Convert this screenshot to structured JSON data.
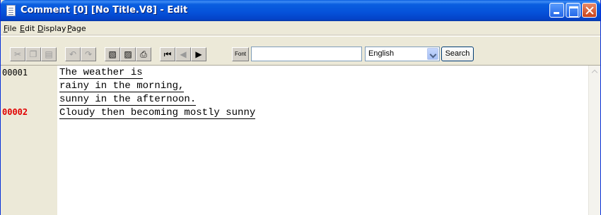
{
  "window": {
    "title": "Comment [0] [No Title.V8] - Edit"
  },
  "menu": [
    {
      "label": "File",
      "accel": "F",
      "rest": "ile"
    },
    {
      "label": "Edit",
      "accel": "E",
      "rest": "dit"
    },
    {
      "label": "Display",
      "accel": "D",
      "rest": "isplay"
    },
    {
      "label": "Page",
      "accel": "P",
      "rest": "age"
    }
  ],
  "toolbar": {
    "font_label": "Font",
    "search_value": "",
    "language": "English",
    "search_label": "Search",
    "icons": [
      "cut-icon",
      "copy-icon",
      "paste-icon",
      "undo-icon",
      "redo-icon",
      "insert-page-icon",
      "copy-page-icon",
      "print-icon",
      "first-page-icon",
      "previous-page-icon",
      "next-page-icon"
    ]
  },
  "editor": {
    "lines": [
      {
        "number": "00001",
        "active": false,
        "text": [
          "The weather is",
          "rainy in the morning,",
          "sunny in the afternoon."
        ]
      },
      {
        "number": "00002",
        "active": true,
        "text": [
          "Cloudy then becoming mostly sunny"
        ]
      }
    ],
    "active_color": "#e00000"
  }
}
